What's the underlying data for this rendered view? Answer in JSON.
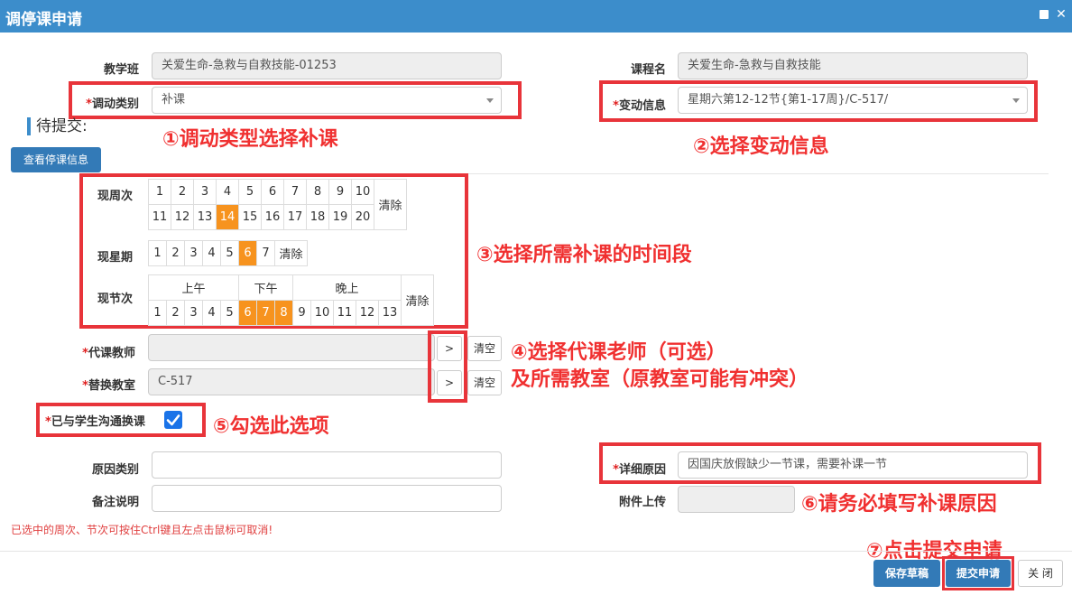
{
  "window": {
    "title": "调停课申请"
  },
  "form": {
    "class_label": "教学班",
    "class_value": "关爱生命-急救与自救技能-01253",
    "course_label": "课程名",
    "course_value": "关爱生命-急救与自救技能",
    "change_type_label": "调动类别",
    "change_type_value": "补课",
    "change_info_label": "变动信息",
    "change_info_value": "星期六第12-12节{第1-17周}/C-517/",
    "pending_title": "待提交:",
    "view_suspension_button": "查看停课信息",
    "week_label": "现周次",
    "weeks_row1": [
      "1",
      "2",
      "3",
      "4",
      "5",
      "6",
      "7",
      "8",
      "9",
      "10"
    ],
    "weeks_row2": [
      "11",
      "12",
      "13",
      "14",
      "15",
      "16",
      "17",
      "18",
      "19",
      "20"
    ],
    "selected_week": "14",
    "clear_label": "清除",
    "weekday_label": "现星期",
    "weekdays": [
      "1",
      "2",
      "3",
      "4",
      "5",
      "6",
      "7"
    ],
    "selected_weekday": "6",
    "period_label": "现节次",
    "period_groups": [
      "上午",
      "下午",
      "晚上"
    ],
    "periods": [
      "1",
      "2",
      "3",
      "4",
      "5",
      "6",
      "7",
      "8",
      "9",
      "10",
      "11",
      "12",
      "13"
    ],
    "selected_periods": [
      "6",
      "7",
      "8"
    ],
    "sub_teacher_label": "代课教师",
    "sub_teacher_value": "",
    "room_label": "替换教室",
    "room_value": "C-517",
    "pick_button": ">",
    "clear_field_button": "清空",
    "communicated_label": "已与学生沟通换课",
    "reason_type_label": "原因类别",
    "reason_type_value": "",
    "detail_reason_label": "详细原因",
    "detail_reason_value": "因国庆放假缺少一节课，需要补课一节",
    "remark_label": "备注说明",
    "remark_value": "",
    "attachment_label": "附件上传",
    "hint": "已选中的周次、节次可按住Ctrl键且左点击鼠标可取消!",
    "save_draft_button": "保存草稿",
    "submit_button": "提交申请",
    "close_button": "关 闭"
  },
  "annotations": {
    "a1": "①调动类型选择补课",
    "a2": "②选择变动信息",
    "a3": "③选择所需补课的时间段",
    "a4_line1": "④选择代课老师（可选）",
    "a4_line2": "及所需教室（原教室可能有冲突）",
    "a5": "⑤勾选此选项",
    "a6": "⑥请务必填写补课原因",
    "a7": "⑦点击提交申请"
  },
  "colors": {
    "header": "#3c8dcb",
    "selected": "#f7931e",
    "annotation": "#e8343a"
  }
}
